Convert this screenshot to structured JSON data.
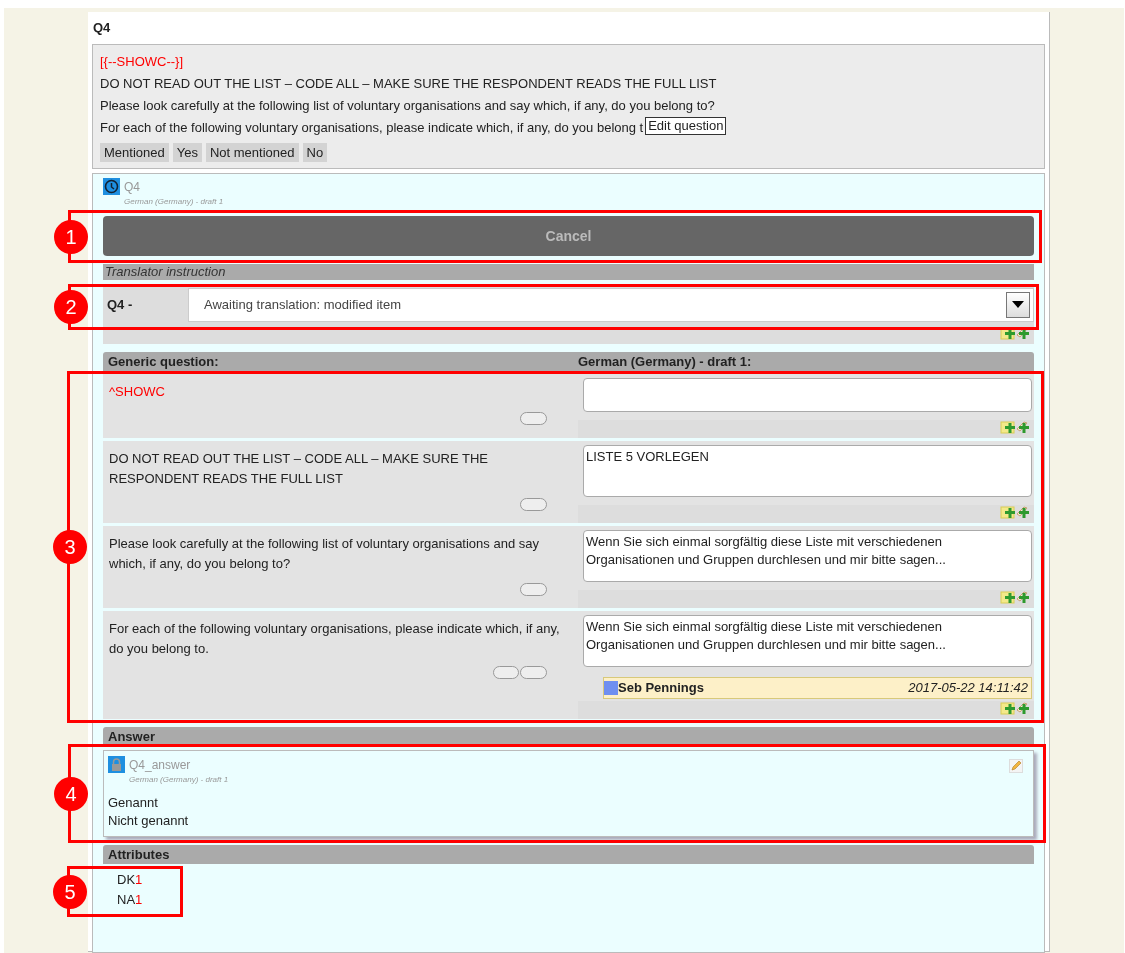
{
  "title": "Q4",
  "question": {
    "lines": [
      {
        "kind": "instruction",
        "text": "[{--SHOWC--}]"
      },
      {
        "kind": "text",
        "text": "DO NOT READ OUT THE LIST – CODE ALL – MAKE SURE THE RESPONDENT READS THE FULL LIST"
      },
      {
        "kind": "text",
        "text": "Please look carefully at the following list of voluntary organisations and say which, if any, do you belong to?"
      },
      {
        "kind": "text",
        "text": "For each of the following voluntary organisations, please indicate which, if any, do you belong t"
      }
    ],
    "answers": [
      "Mentioned",
      "Yes",
      "Not mentioned",
      "No"
    ],
    "tooltip": "Edit question"
  },
  "translation": {
    "name": "Q4",
    "language": "German (Germany) - draft 1",
    "cancel": "Cancel",
    "instruction_label": "Translator instruction",
    "status_label": "Q4 -",
    "status_value": "Awaiting translation: modified item",
    "generic_header": "Generic question:",
    "target_header": "German (Germany) - draft 1:",
    "rows": [
      {
        "kind": "instruction",
        "source": "^SHOWC",
        "buttons": [
          {
            "kind": "copy"
          }
        ]
      },
      {
        "kind": "text",
        "source": "DO NOT READ OUT THE LIST – CODE ALL – MAKE SURE THE RESPONDENT READS THE FULL LIST",
        "target": "LISTE 5 VORLEGEN",
        "buttons": [
          {
            "kind": "copy"
          }
        ]
      },
      {
        "kind": "text",
        "source": "Please look carefully at the following list of voluntary organisations and say which, if any, do you belong to?",
        "target": "Wenn Sie sich einmal sorgfältig diese Liste mit verschiedenen Organisationen und Gruppen durchlesen und mir bitte sagen...",
        "buttons": [
          {
            "kind": "copy"
          }
        ]
      },
      {
        "kind": "text",
        "source": "For each of the following voluntary organisations, please indicate which, if any, do you belong to.",
        "target": "Wenn Sie sich einmal sorgfältig diese Liste mit verschiedenen Organisationen und Gruppen durchlesen und mir bitte sagen...",
        "buttons": [
          {
            "kind": "mark"
          },
          {
            "kind": "copy"
          }
        ],
        "comment": {
          "author": "Seb Pennings",
          "time": "2017-05-22 14:11:42",
          "color": "#6f8ff0"
        }
      }
    ]
  },
  "answer": {
    "header": "Answer",
    "name": "Q4_answer",
    "language": "German (Germany) - draft 1",
    "locked": true,
    "options": [
      "Genannt",
      "Nicht genannt"
    ]
  },
  "attributes": {
    "header": "Attributes",
    "items": [
      {
        "code": "DK",
        "value": "1"
      },
      {
        "code": "NA",
        "value": "1"
      }
    ]
  },
  "callouts": [
    {
      "number": "1"
    },
    {
      "number": "2"
    },
    {
      "number": "3"
    },
    {
      "number": "4"
    },
    {
      "number": "5"
    }
  ]
}
